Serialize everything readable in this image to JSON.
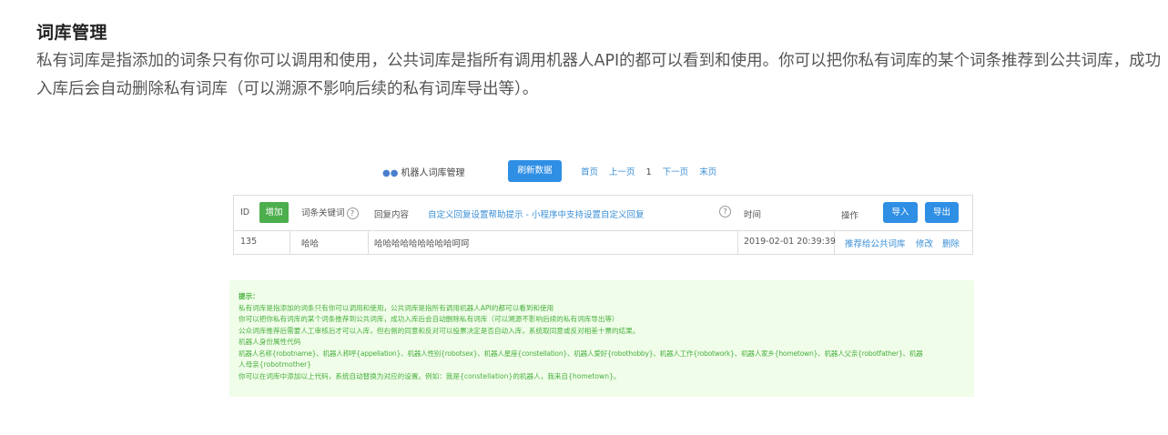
{
  "doc": {
    "title": "词库管理",
    "paragraph": "私有词库是指添加的词条只有你可以调用和使用，公共词库是指所有调用机器人API的都可以看到和使用。你可以把你私有词库的某个词条推荐到公共词库，成功入库后会自动删除私有词库（可以溯源不影响后续的私有词库导出等）。"
  },
  "screenshot": {
    "header": {
      "title": "机器人词库管理",
      "refresh_label": "刷新数据",
      "pager": {
        "first": "首页",
        "prev": "上一页",
        "current": "1",
        "next": "下一页",
        "last": "末页"
      }
    },
    "table": {
      "columns": {
        "id": "ID",
        "add": "增加",
        "keyword": "词条关键词",
        "reply": "回复内容",
        "help_link": "自定义回复设置帮助提示 - 小程序中支持设置自定义回复",
        "time": "时间",
        "ops": "操作",
        "import": "导入",
        "export": "导出"
      },
      "rows": [
        {
          "id": "135",
          "keyword": "哈哈",
          "reply": "哈哈哈哈哈哈哈哈哈呵呵",
          "time": "2019-02-01 20:39:39",
          "recommend": "推荐给公共词库",
          "edit": "修改",
          "delete": "删除"
        }
      ]
    },
    "hint": {
      "lines": [
        "提示：",
        "私有词库是指添加的词条只有你可以调用和使用，公共词库是指所有调用机器人API的都可以看到和使用",
        "你可以把你私有词库的某个词条推荐到公共词库，成功入库后会自动删除私有词库（可以溯源不影响后续的私有词库导出等）",
        "公众词库推荐后需要人工审核后才可以入库，但右侧的同意和反对可以投票决定是否自动入库，系统取同意或反对相差十票的结果。",
        "机器人身份属性代码",
        "机器人名称{robotname}、机器人称呼{appellation}、机器人性别{robotsex}、机器人星座{constellation}、机器人爱好{robothobby}、机器人工作{robotwork}、机器人家乡{hometown}、机器人父亲{robotfather}、机器",
        "人母亲{robotmother}",
        "你可以在词库中添加以上代码，系统自动替换为对应的设置。例如：我是{constellation}的机器人，我来自{hometown}。"
      ]
    }
  }
}
